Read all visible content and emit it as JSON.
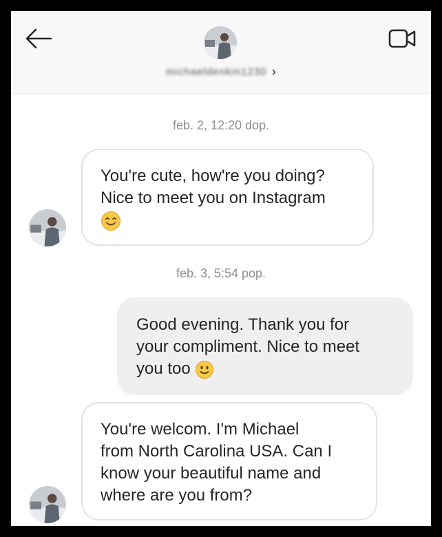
{
  "header": {
    "username": "michaeldenkin1230",
    "chevron": "›",
    "back_icon": "arrow-left-icon",
    "video_icon": "video-camera-icon"
  },
  "messages": [
    {
      "timestamp": "feb. 2, 12:20 dop."
    },
    {
      "direction": "incoming",
      "line1": "You're cute, how're you doing?",
      "line2": "Nice to meet you on Instagram",
      "emoji": "smiling-face-icon"
    },
    {
      "timestamp": "feb. 3, 5:54 pop."
    },
    {
      "direction": "outgoing",
      "line1": "Good evening. Thank you for",
      "line2": "your compliment. Nice to meet",
      "line3": "you too",
      "emoji": "slightly-smiling-face-icon"
    },
    {
      "direction": "incoming",
      "line1": "You're welcom. I'm Michael",
      "line2": "from North Carolina USA. Can I",
      "line3": "know your beautiful name and",
      "line4": "where are you from?"
    }
  ],
  "colors": {
    "incoming_bg": "#ffffff",
    "incoming_border": "#e3e3e3",
    "outgoing_bg": "#efefef",
    "timestamp": "#8e8e8e",
    "emoji": "#f7c84a"
  }
}
